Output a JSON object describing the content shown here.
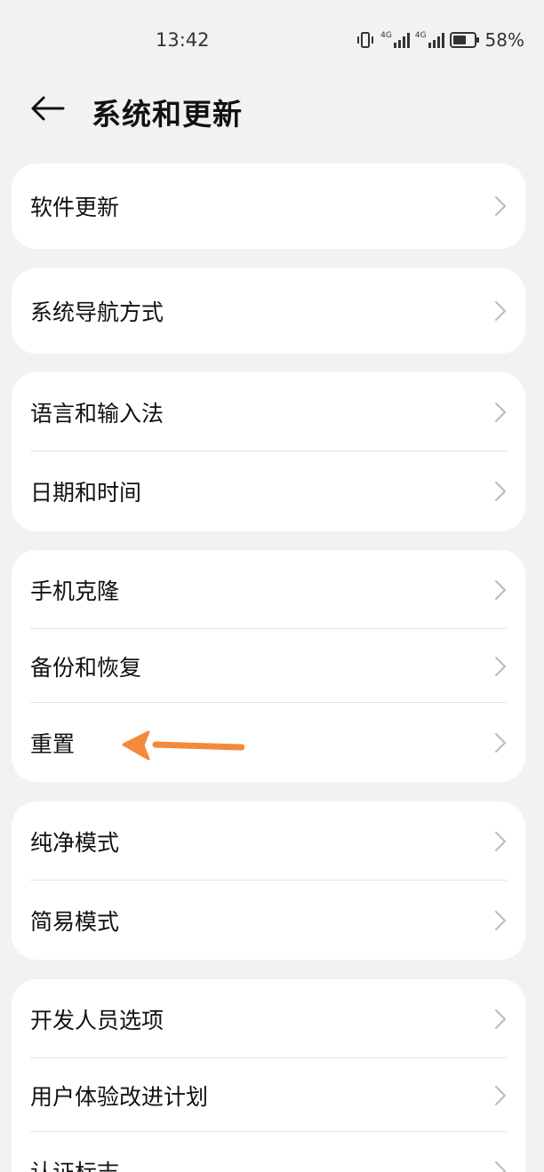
{
  "status": {
    "time": "13:42",
    "battery": "58%",
    "network_1": "4G",
    "network_2": "4G"
  },
  "header": {
    "title": "系统和更新"
  },
  "groups": [
    {
      "items": [
        {
          "label": "软件更新"
        }
      ]
    },
    {
      "items": [
        {
          "label": "系统导航方式"
        }
      ]
    },
    {
      "items": [
        {
          "label": "语言和输入法"
        },
        {
          "label": "日期和时间"
        }
      ]
    },
    {
      "items": [
        {
          "label": "手机克隆"
        },
        {
          "label": "备份和恢复"
        },
        {
          "label": "重置"
        }
      ]
    },
    {
      "items": [
        {
          "label": "纯净模式"
        },
        {
          "label": "简易模式"
        }
      ]
    },
    {
      "items": [
        {
          "label": "开发人员选项"
        },
        {
          "label": "用户体验改进计划"
        },
        {
          "label": "认证标志"
        }
      ]
    }
  ],
  "colors": {
    "background": "#f1f2f4",
    "card": "#ffffff",
    "annotation_arrow": "#f5893a",
    "chevron": "#bdbdbd"
  },
  "icons": {
    "back": "arrow-left-icon",
    "chevron": "chevron-right-icon",
    "vibrate": "vibrate-icon",
    "signal": "signal-icon",
    "battery": "battery-icon"
  }
}
